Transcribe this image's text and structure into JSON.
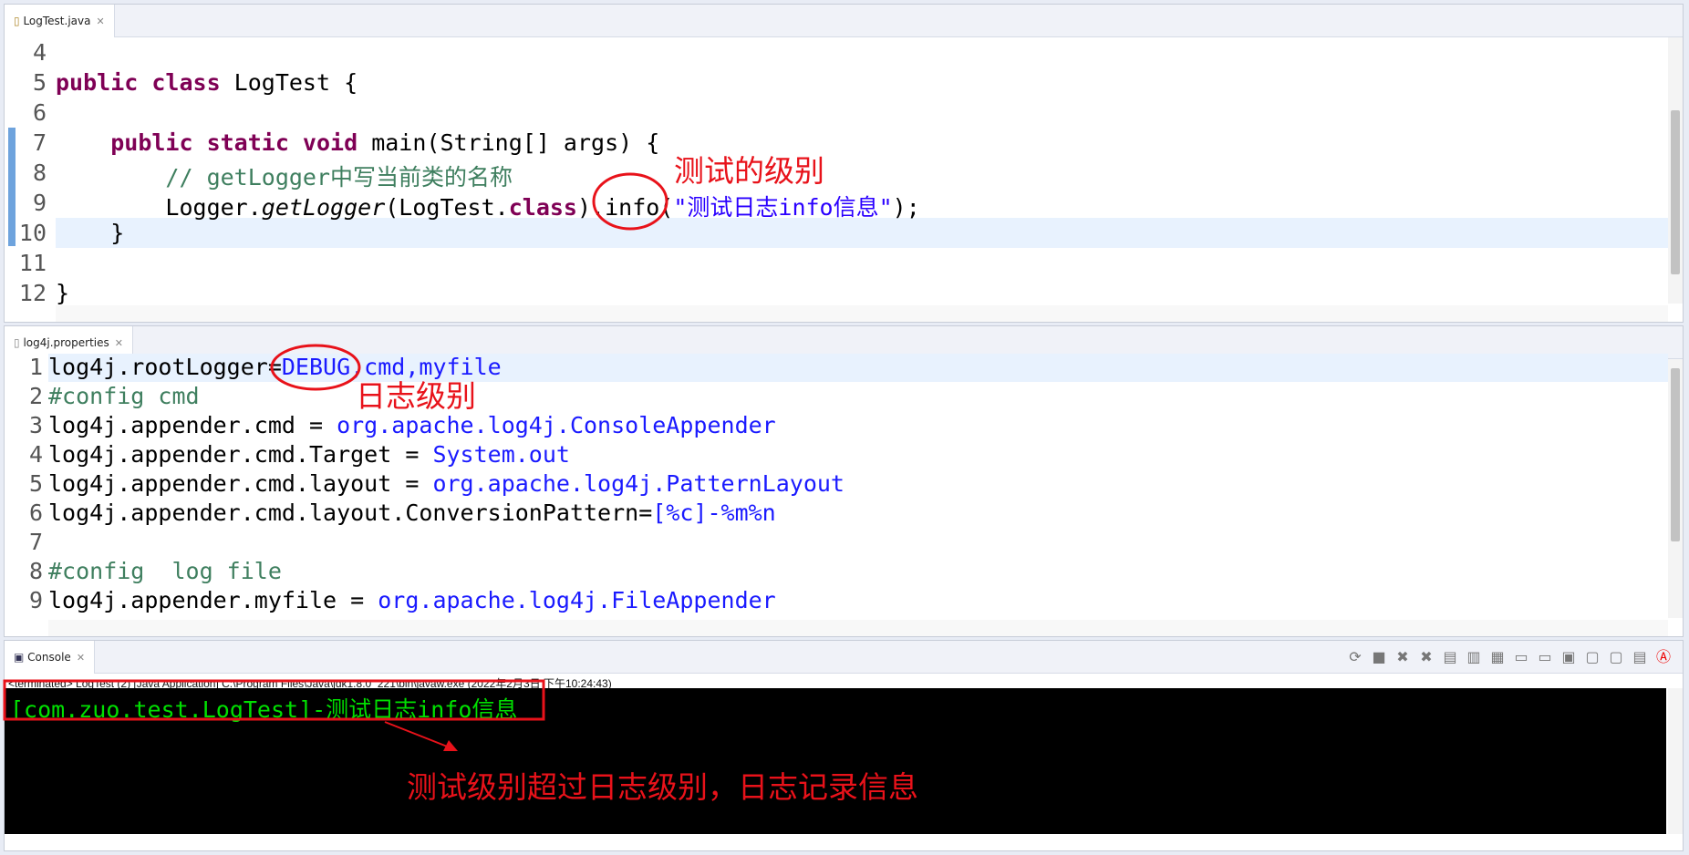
{
  "editor1": {
    "tab": "LogTest.java",
    "lines": [
      {
        "n": "4",
        "html": ""
      },
      {
        "n": "5",
        "html": "<span class=\"kw\">public class</span> LogTest {"
      },
      {
        "n": "6",
        "html": ""
      },
      {
        "n": "7",
        "html": "    <span class=\"kw\">public static void</span> main(String[] args) {"
      },
      {
        "n": "8",
        "html": "        <span class=\"cm\">// getLogger中写当前类的名称</span>"
      },
      {
        "n": "9",
        "html": "        Logger.<span class=\"it\">getLogger</span>(LogTest.<span class=\"kw\">class</span>).info(<span class=\"st\">\"测试日志info信息\"</span>);"
      },
      {
        "n": "10",
        "html": "    }"
      },
      {
        "n": "11",
        "html": ""
      },
      {
        "n": "12",
        "html": "}"
      }
    ]
  },
  "editor2": {
    "tab": "log4j.properties",
    "lines": [
      {
        "n": "1",
        "html": "log4j.rootLogger=<span class=\"bl\">DEBUG,cmd,myfile</span>"
      },
      {
        "n": "2",
        "html": "<span class=\"cm\">#config cmd</span>"
      },
      {
        "n": "3",
        "html": "log4j.appender.cmd = <span class=\"bl\">org.apache.log4j.ConsoleAppender</span>"
      },
      {
        "n": "4",
        "html": "log4j.appender.cmd.Target = <span class=\"bl\">System.out</span>"
      },
      {
        "n": "5",
        "html": "log4j.appender.cmd.layout = <span class=\"bl\">org.apache.log4j.PatternLayout</span>"
      },
      {
        "n": "6",
        "html": "log4j.appender.cmd.layout.ConversionPattern=<span class=\"bl\">[%c]-%m%n</span>"
      },
      {
        "n": "7",
        "html": ""
      },
      {
        "n": "8",
        "html": "<span class=\"cm\">#config  log file</span>"
      },
      {
        "n": "9",
        "html": "log4j.appender.myfile = <span class=\"bl\">org.apache.log4j.FileAppender</span>"
      }
    ]
  },
  "console": {
    "tab": "Console",
    "status": "<terminated> LogTest (2) [Java Application] C:\\Program Files\\Java\\jdk1.8.0_221\\bin\\javaw.exe (2022年2月3日 下午10:24:43)",
    "output": "[com.zuo.test.LogTest]-测试日志info信息",
    "output_color": "#00e000",
    "toolbar_icons": [
      "relaunch-icon",
      "terminate-icon",
      "remove-launch-icon",
      "remove-all-icon",
      "clear-console-icon",
      "scroll-lock-icon",
      "word-wrap-icon",
      "show-on-stdout-icon",
      "show-on-stderr-icon",
      "pin-console-icon",
      "display-console-icon",
      "open-console-icon",
      "copy-icon",
      "ant-icon"
    ]
  },
  "annotations": {
    "level_label": "测试的级别",
    "log_level_label": "日志级别",
    "result_label": "测试级别超过日志级别，日志记录信息",
    "color": "#e8121a"
  }
}
